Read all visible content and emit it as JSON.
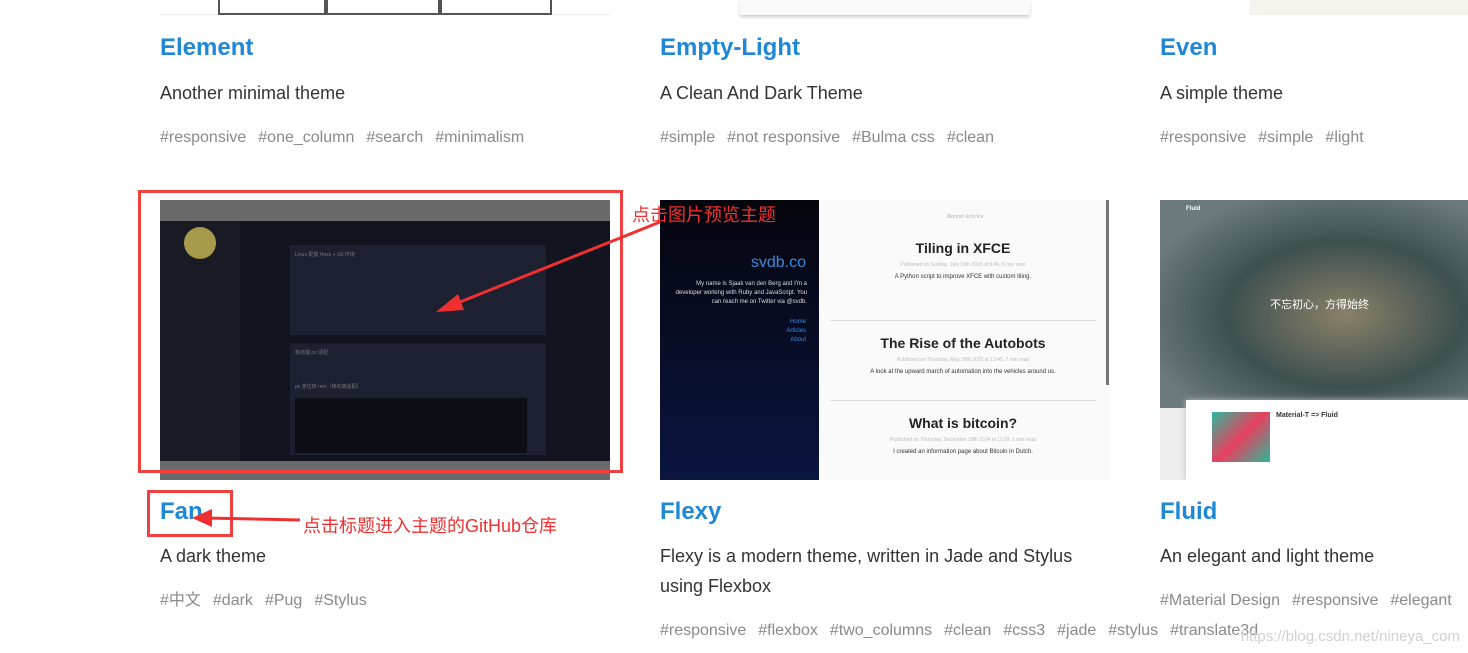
{
  "themes": [
    {
      "name": "Element",
      "desc": "Another minimal theme",
      "tags": [
        "#responsive",
        "#one_column",
        "#search",
        "#minimalism"
      ]
    },
    {
      "name": "Empty-Light",
      "desc": "A Clean And Dark Theme",
      "tags": [
        "#simple",
        "#not responsive",
        "#Bulma css",
        "#clean"
      ]
    },
    {
      "name": "Even",
      "desc": "A simple theme",
      "tags": [
        "#responsive",
        "#simple",
        "#light"
      ]
    },
    {
      "name": "Fan",
      "desc": "A dark theme",
      "tags": [
        "#中文",
        "#dark",
        "#Pug",
        "#Stylus"
      ],
      "preview": {
        "post1": "Linux 配置 Hexo + Git 环境",
        "post2": "移动端 px 适配",
        "heading": "px 单位转 rem（移动端适配）"
      }
    },
    {
      "name": "Flexy",
      "desc": "Flexy is a modern theme, written in Jade and Stylus using Flexbox",
      "tags": [
        "#responsive",
        "#flexbox",
        "#two_columns",
        "#clean",
        "#css3",
        "#jade",
        "#stylus",
        "#translate3d"
      ],
      "preview": {
        "site": "svdb.co",
        "bio": "My name is Sjaak van den Berg and I'm a developer working with Ruby and JavaScript. You can reach me on Twitter via @svdb.",
        "nav": [
          "Home",
          "Articles",
          "About"
        ],
        "recent": "Recent Articles",
        "articles": [
          {
            "t": "Tiling in XFCE",
            "m": "Published on Sunday, July 19th 2015 at 9:46, 5 min read",
            "d": "A Python script to improve XFCE with custom tiling."
          },
          {
            "t": "The Rise of the Autobots",
            "m": "Published on Thursday, May 28th 2015 at 13:45, 7 min read",
            "d": "A look at the upward march of automation into the vehicles around us."
          },
          {
            "t": "What is bitcoin?",
            "m": "Published on Thursday, December 18th 2014 at 11:59, 1 min read",
            "d": "I created an information page about Bitcoin in Dutch."
          }
        ]
      }
    },
    {
      "name": "Fluid",
      "desc": "An elegant and light theme",
      "tags": [
        "#Material Design",
        "#responsive",
        "#elegant"
      ],
      "preview": {
        "brand": "Fluid",
        "slogan": "不忘初心，方得始终",
        "post": "Material-T => Fluid"
      }
    }
  ],
  "annotations": {
    "preview": "点击图片预览主题",
    "title": "点击标题进入主题的GitHub仓库"
  },
  "watermark": "https://blog.csdn.net/nineya_com"
}
